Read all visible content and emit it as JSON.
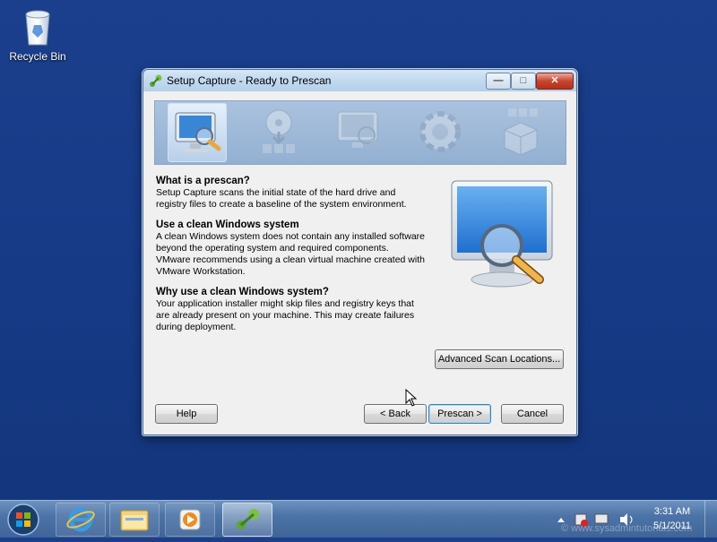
{
  "desktop": {
    "recycle_bin_label": "Recycle Bin"
  },
  "window": {
    "title": "Setup Capture - Ready to Prescan",
    "steps": [
      "scan-icon",
      "install-icon",
      "postscan-icon",
      "configure-icon",
      "package-icon"
    ]
  },
  "content": {
    "sections": [
      {
        "heading": "What is a prescan?",
        "body": "Setup Capture scans the initial state of the hard drive and registry files to create a baseline of the system environment."
      },
      {
        "heading": "Use a clean Windows system",
        "body": "A clean Windows system does not contain any installed software beyond the operating system and required components. VMware recommends using a clean virtual machine created with VMware Workstation."
      },
      {
        "heading": "Why use a clean Windows system?",
        "body": "Your application installer might skip files and registry keys that are already present on your machine. This may create failures during deployment."
      }
    ]
  },
  "buttons": {
    "advanced": "Advanced Scan Locations...",
    "help": "Help",
    "back": "< Back",
    "prescan": "Prescan >",
    "cancel": "Cancel"
  },
  "taskbar": {
    "apps": [
      "start-orb",
      "internet-explorer-icon",
      "windows-explorer-icon",
      "media-player-icon",
      "thinapp-icon"
    ],
    "time": "3:31 AM",
    "date": "5/1/2011"
  },
  "watermark": "© www.sysadmintutorials.com",
  "colors": {
    "desktop": "#1b3f8c",
    "accent": "#3c7fb1"
  }
}
